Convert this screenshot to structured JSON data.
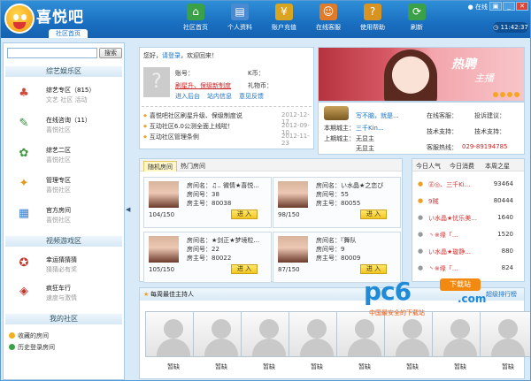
{
  "app": {
    "brand": "喜悦吧",
    "home_tab": "社区首页",
    "status": "在线",
    "clock": "11:42:37"
  },
  "nav": [
    {
      "label": "社区首页",
      "icon": "home-icon",
      "glyph": "⌂",
      "color": "#3aa148"
    },
    {
      "label": "个人资料",
      "icon": "profile-icon",
      "glyph": "▤",
      "color": "#4a8ad0"
    },
    {
      "label": "账户充值",
      "icon": "recharge-icon",
      "glyph": "¥",
      "color": "#d9a520"
    },
    {
      "label": "在线客服",
      "icon": "support-icon",
      "glyph": "☺",
      "color": "#e07b2a"
    },
    {
      "label": "使用帮助",
      "icon": "help-icon",
      "glyph": "?",
      "color": "#d99320"
    },
    {
      "label": "刷新",
      "icon": "refresh-icon",
      "glyph": "⟳",
      "color": "#3aa148"
    }
  ],
  "sidebar": {
    "search_placeholder": "",
    "search_button": "搜索",
    "section1": "综艺娱乐区",
    "categories": [
      {
        "name": "综艺专区（815）",
        "sub": "文艺 社区 活动",
        "icon": "entertainment-icon",
        "glyph": "♣",
        "color": "#d24a3a"
      },
      {
        "name": "在线咨询（11）",
        "sub": "喜悦社区",
        "icon": "consult-icon",
        "glyph": "✎",
        "color": "#2c8a3a"
      },
      {
        "name": "综艺二区",
        "sub": "喜悦社区",
        "icon": "zone-icon",
        "glyph": "✿",
        "color": "#3a9a3a"
      },
      {
        "name": "管理专区",
        "sub": "喜悦社区",
        "icon": "admin-icon",
        "glyph": "✦",
        "color": "#e39a1a"
      },
      {
        "name": "官方房间",
        "sub": "喜悦社区",
        "icon": "official-icon",
        "glyph": "▦",
        "color": "#3a7fd0"
      }
    ],
    "section2": "视频游戏区",
    "games": [
      {
        "name": "幸运猜猜猜",
        "sub": "猜猜必有奖",
        "icon": "lucky-icon",
        "glyph": "✪",
        "color": "#c3342a"
      },
      {
        "name": "疯狂车行",
        "sub": "速度与激情",
        "icon": "car-icon",
        "glyph": "◈",
        "color": "#c3342a"
      }
    ],
    "section3": "我的社区",
    "links": [
      {
        "label": "收藏的房间",
        "icon": "favorite-icon",
        "color": "#f0b020"
      },
      {
        "label": "历史登录房间",
        "icon": "history-icon",
        "color": "#3aa148"
      }
    ]
  },
  "login": {
    "welcome_prefix": "您好，",
    "login_link": "请登录",
    "welcome_suffix": "，欢迎回来！",
    "account_label": "账号：",
    "k_label": "K币：",
    "gift_label": "礼物币：",
    "promo": "刷星升、保级新制度",
    "actions": [
      "进入后台",
      "站内信息",
      "意见反馈"
    ],
    "news": [
      {
        "title": "喜悦吧社区刷星升级、保级制度说",
        "date": "2012-12-17"
      },
      {
        "title": "互动社区6.0公测全面上线啦！",
        "date": "2012-09-10"
      },
      {
        "title": "互动社区管理条例",
        "date": "2012-11-23"
      }
    ]
  },
  "banner": {
    "title": "热聘",
    "subtitle": "主播"
  },
  "keeper": {
    "keeper_label": "本期城主：",
    "keeper_name": "写不脑，就是...",
    "keeper_vip": "三千Kin...",
    "prev_label": "上期城主：",
    "prev_name": "无显主",
    "prev_name2": "无显主",
    "cs_label": "在线客服：",
    "complaint_label": "投诉建议：",
    "tech_label": "技术支持：",
    "tech_label2": "技术支持：",
    "phone_label": "客服热线：",
    "phone": "029-89194785"
  },
  "rooms": {
    "tabs": [
      "随机房间",
      "热门房间"
    ],
    "name_label": "房间名：",
    "num_label": "房间号：",
    "owner_label": "房主号：",
    "enter": "进 入",
    "items": [
      {
        "name": "♫.. 微情★喜悦...",
        "num": "38",
        "owner": "80038",
        "count": "104/150"
      },
      {
        "name": "い水晶★之恋び",
        "num": "55",
        "owner": "80055",
        "count": "98/150"
      },
      {
        "name": "★剑正★梦境粒...",
        "num": "22",
        "owner": "80022",
        "count": "105/150"
      },
      {
        "name": "『舞队",
        "num": "9",
        "owner": "80009",
        "count": "87/150"
      }
    ]
  },
  "rank": {
    "tabs": [
      "今日人气",
      "今日消费",
      "本周之星"
    ],
    "rows": [
      {
        "name": "㊣◎、三千Ki...",
        "value": "93464"
      },
      {
        "name": "9贼",
        "value": "80444"
      },
      {
        "name": "い水晶★忧乐美...",
        "value": "1640"
      },
      {
        "name": "丶※缘「...",
        "value": "1520"
      },
      {
        "name": "い水晶★璇静...",
        "value": "880"
      },
      {
        "name": "丶※缘「...",
        "value": "824"
      }
    ]
  },
  "hosts": {
    "title": "每周最佳主持人",
    "more": "超级排行榜",
    "empty_label": "暂缺",
    "count": 8
  },
  "watermark": {
    "logo": "pc6",
    "badge": "下载站",
    "domain": ".com",
    "slogan": "中国最安全的下载站"
  }
}
